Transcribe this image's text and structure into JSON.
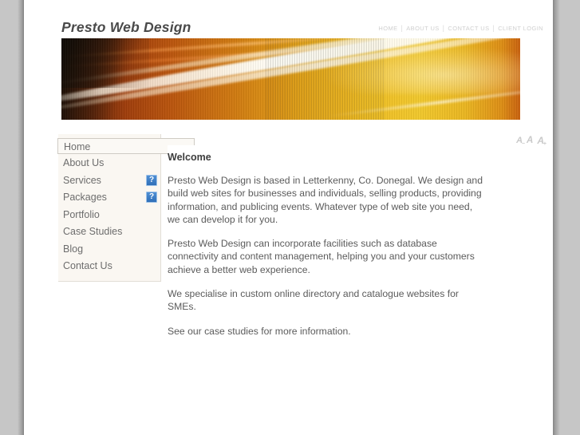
{
  "site": {
    "logo": "Presto Web Design"
  },
  "topnav": {
    "separator": "|",
    "items": [
      {
        "label": "HOME"
      },
      {
        "label": "ABOUT US"
      },
      {
        "label": "CONTACT US"
      },
      {
        "label": "CLIENT LOGIN"
      }
    ]
  },
  "fontsize": {
    "decrease": {
      "letter": "A",
      "mark": "−",
      "name": "decrease-font-size"
    },
    "normal": {
      "letter": "A",
      "mark": "",
      "name": "reset-font-size"
    },
    "increase": {
      "letter": "A",
      "mark": "+",
      "name": "increase-font-size"
    }
  },
  "sidebar": {
    "items": [
      {
        "label": "Home",
        "active": true,
        "icon": null
      },
      {
        "label": "About Us",
        "active": false,
        "icon": null
      },
      {
        "label": "Services",
        "active": false,
        "icon": "broken-image-icon"
      },
      {
        "label": "Packages",
        "active": false,
        "icon": "broken-image-icon"
      },
      {
        "label": "Portfolio",
        "active": false,
        "icon": null
      },
      {
        "label": "Case Studies",
        "active": false,
        "icon": null
      },
      {
        "label": "Blog",
        "active": false,
        "icon": null
      },
      {
        "label": "Contact Us",
        "active": false,
        "icon": null
      }
    ]
  },
  "content": {
    "heading": "Welcome",
    "paragraphs": [
      "Presto Web Design is based in Letterkenny, Co. Donegal. We design and build web sites for businesses and individuals, selling products, providing information, and publicing events. Whatever type of web site you need, we can develop it for you.",
      "Presto Web Design can incorporate facilities such as database connectivity and content management, helping you and your customers achieve a better web experience.",
      "We specialise in custom online directory and catalogue websites for SMEs.",
      "See our case studies for more information."
    ]
  },
  "colors": {
    "page_background": "#ffffff",
    "frame_gray": "#c6c6c6",
    "sidebar_background": "#faf7f2",
    "logo_text": "#4a4a4a",
    "body_text": "#5b5b5b",
    "nav_text": "#6d6d6d",
    "topnav_text": "#d0d0d0",
    "banner_accent": "#e2a218"
  }
}
